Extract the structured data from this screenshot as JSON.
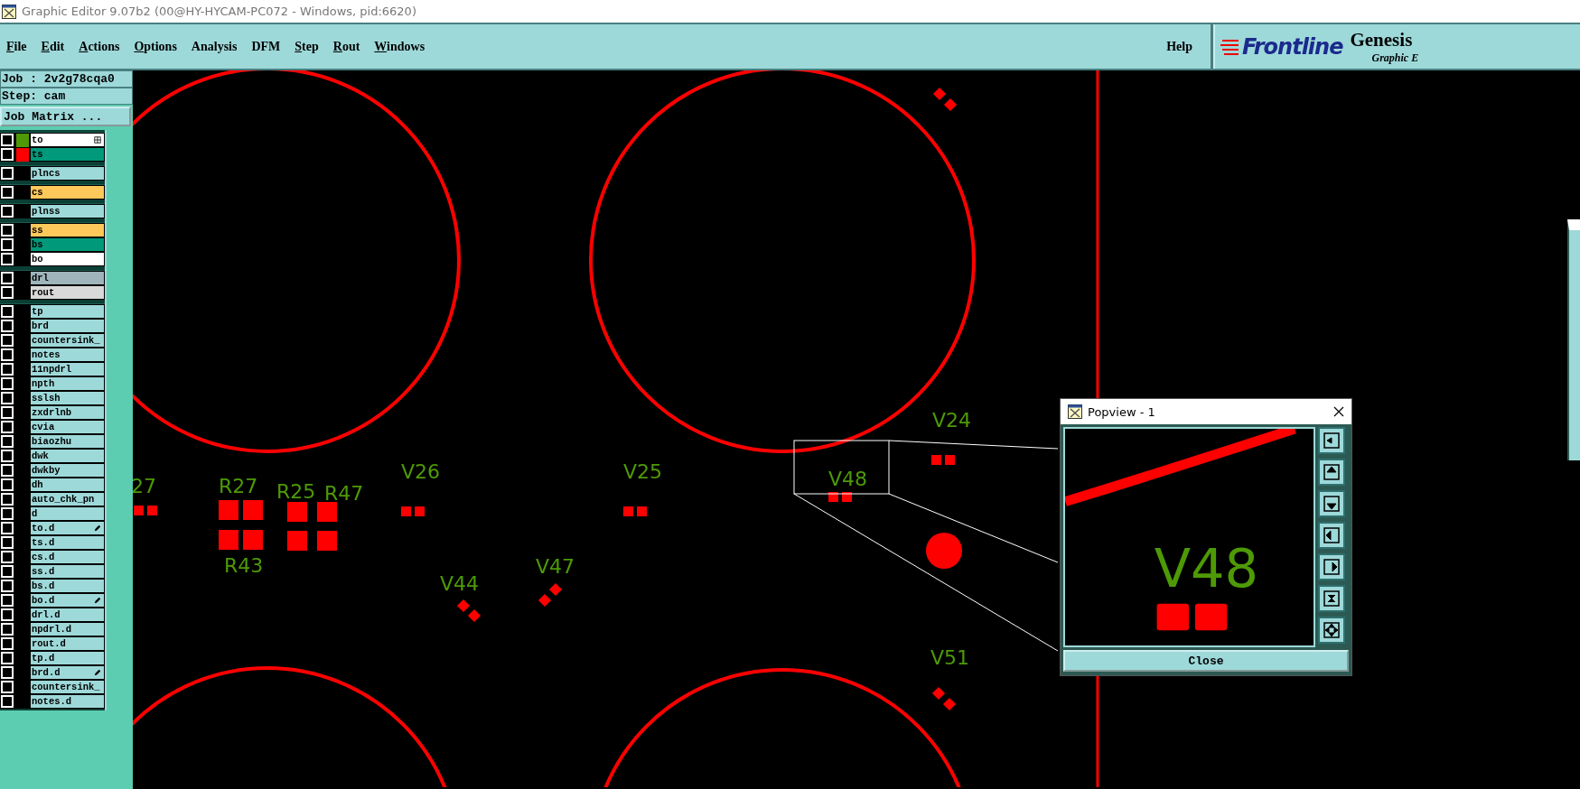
{
  "window": {
    "title": "Graphic Editor 9.07b2 (00@HY-HYCAM-PC072 - Windows, pid:6620)"
  },
  "menu": [
    {
      "label": "File",
      "underline": true
    },
    {
      "label": "Edit",
      "underline": true
    },
    {
      "label": "Actions",
      "underline": true
    },
    {
      "label": "Options",
      "underline": true
    },
    {
      "label": "Analysis",
      "underline": false
    },
    {
      "label": "DFM",
      "underline": false
    },
    {
      "label": "Step",
      "underline": true
    },
    {
      "label": "Rout",
      "underline": true
    },
    {
      "label": "Windows",
      "underline": true
    }
  ],
  "help": "Help",
  "logo": {
    "brand": "Frontline",
    "product": "Genesis",
    "subtitle": "Graphic E"
  },
  "job_panel": {
    "job": "Job : 2v2g78cqa0",
    "step": "Step: cam",
    "button": "Job Matrix ..."
  },
  "layer_groups": [
    [
      {
        "name": "to",
        "kind": "white",
        "color": "#4e9a06",
        "checked": false,
        "expandable": true,
        "edited": false
      },
      {
        "name": "ts",
        "kind": "green",
        "color": "#ff0000",
        "checked": false,
        "expandable": false,
        "edited": false
      }
    ],
    [
      {
        "name": "plncs",
        "kind": "plain",
        "checked": false,
        "expandable": false,
        "edited": false
      }
    ],
    [
      {
        "name": "cs",
        "kind": "orange",
        "checked": false,
        "expandable": false,
        "edited": false
      }
    ],
    [
      {
        "name": "plnss",
        "kind": "plain",
        "checked": false,
        "expandable": false,
        "edited": false
      }
    ],
    [
      {
        "name": "ss",
        "kind": "orange",
        "checked": false,
        "expandable": false,
        "edited": false
      },
      {
        "name": "bs",
        "kind": "green",
        "checked": false,
        "expandable": false,
        "edited": false
      },
      {
        "name": "bo",
        "kind": "white",
        "checked": false,
        "expandable": false,
        "edited": false
      }
    ],
    [
      {
        "name": "drl",
        "kind": "slate",
        "checked": false,
        "expandable": false,
        "edited": false
      },
      {
        "name": "rout",
        "kind": "grey",
        "checked": false,
        "expandable": false,
        "edited": false
      }
    ],
    [
      {
        "name": "tp",
        "kind": "plain",
        "checked": false,
        "expandable": false,
        "edited": false
      },
      {
        "name": "brd",
        "kind": "plain",
        "checked": false,
        "expandable": false,
        "edited": false
      },
      {
        "name": "countersink_",
        "kind": "plain",
        "checked": false,
        "expandable": false,
        "edited": false
      },
      {
        "name": "notes",
        "kind": "plain",
        "checked": false,
        "expandable": false,
        "edited": false
      },
      {
        "name": "11npdrl",
        "kind": "plain",
        "checked": false,
        "expandable": false,
        "edited": false
      },
      {
        "name": "npth",
        "kind": "plain",
        "checked": false,
        "expandable": false,
        "edited": false
      },
      {
        "name": "sslsh",
        "kind": "plain",
        "checked": false,
        "expandable": false,
        "edited": false
      },
      {
        "name": "zxdrlnb",
        "kind": "plain",
        "checked": false,
        "expandable": false,
        "edited": false
      },
      {
        "name": "cvia",
        "kind": "plain",
        "checked": false,
        "expandable": false,
        "edited": false
      },
      {
        "name": "biaozhu",
        "kind": "plain",
        "checked": false,
        "expandable": false,
        "edited": false
      },
      {
        "name": "dwk",
        "kind": "plain",
        "checked": false,
        "expandable": false,
        "edited": false
      },
      {
        "name": "dwkby",
        "kind": "plain",
        "checked": false,
        "expandable": false,
        "edited": false
      },
      {
        "name": "dh",
        "kind": "plain",
        "checked": false,
        "expandable": false,
        "edited": false
      },
      {
        "name": "auto_chk_pn",
        "kind": "plain",
        "checked": false,
        "expandable": false,
        "edited": false
      },
      {
        "name": "d",
        "kind": "plain",
        "checked": false,
        "expandable": false,
        "edited": false
      },
      {
        "name": "to.d",
        "kind": "plain",
        "checked": false,
        "expandable": false,
        "edited": true
      },
      {
        "name": "ts.d",
        "kind": "plain",
        "checked": false,
        "expandable": false,
        "edited": false
      },
      {
        "name": "cs.d",
        "kind": "plain",
        "checked": false,
        "expandable": false,
        "edited": false
      },
      {
        "name": "ss.d",
        "kind": "plain",
        "checked": false,
        "expandable": false,
        "edited": false
      },
      {
        "name": "bs.d",
        "kind": "plain",
        "checked": false,
        "expandable": false,
        "edited": false
      },
      {
        "name": "bo.d",
        "kind": "plain",
        "checked": false,
        "expandable": false,
        "edited": true
      },
      {
        "name": "drl.d",
        "kind": "plain",
        "checked": false,
        "expandable": false,
        "edited": false
      },
      {
        "name": "npdrl.d",
        "kind": "plain",
        "checked": false,
        "expandable": false,
        "edited": false
      },
      {
        "name": "rout.d",
        "kind": "plain",
        "checked": false,
        "expandable": false,
        "edited": false
      },
      {
        "name": "tp.d",
        "kind": "plain",
        "checked": false,
        "expandable": false,
        "edited": false
      },
      {
        "name": "brd.d",
        "kind": "plain",
        "checked": false,
        "expandable": false,
        "edited": true
      },
      {
        "name": "countersink_",
        "kind": "plain",
        "checked": false,
        "expandable": false,
        "edited": false
      },
      {
        "name": "notes.d",
        "kind": "plain",
        "checked": false,
        "expandable": false,
        "edited": false
      }
    ]
  ],
  "canvas": {
    "labels": [
      "27",
      "R27",
      "R25",
      "R47",
      "R43",
      "V26",
      "V25",
      "V44",
      "V47",
      "V24",
      "V48",
      "V51"
    ]
  },
  "popview": {
    "title": "Popview - 1",
    "label": "V48",
    "close": "Close"
  }
}
